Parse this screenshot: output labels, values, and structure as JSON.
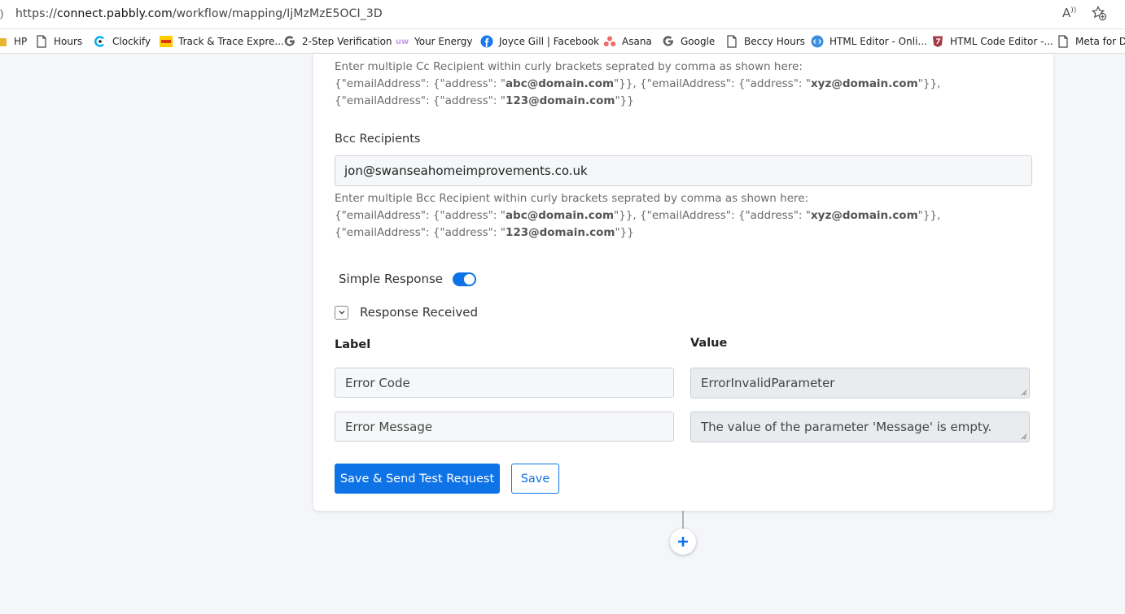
{
  "browser": {
    "lead_char": ")",
    "url_prefix": "https://",
    "url_host": "connect.pabbly.com",
    "url_path": "/workflow/mapping/IjMzMzE5OCI_3D",
    "read_aloud_glyph": "Aͅ",
    "read_aloud_icon": "read-aloud-icon",
    "favorites_icon": "add-favorite-icon"
  },
  "bookmarks": [
    {
      "label": "HP",
      "icon": "folder-icon"
    },
    {
      "label": "Hours",
      "icon": "page-icon"
    },
    {
      "label": "Clockify",
      "icon": "clockify-icon"
    },
    {
      "label": "Track & Trace Expre...",
      "icon": "dhl-icon"
    },
    {
      "label": "2-Step Verification",
      "icon": "google-icon"
    },
    {
      "label": "Your Energy",
      "icon": "utility-warehouse-icon"
    },
    {
      "label": "Joyce Gill | Facebook",
      "icon": "facebook-icon"
    },
    {
      "label": "Asana",
      "icon": "asana-icon"
    },
    {
      "label": "Google",
      "icon": "google-icon"
    },
    {
      "label": "Beccy Hours",
      "icon": "page-icon"
    },
    {
      "label": "HTML Editor - Onli...",
      "icon": "html-editor-icon"
    },
    {
      "label": "HTML Code Editor -...",
      "icon": "shield-icon"
    },
    {
      "label": "Meta for De",
      "icon": "page-icon"
    }
  ],
  "cc_hint": {
    "line1": "Enter multiple Cc Recipient within curly brackets seprated by comma as shown here:",
    "p1": "{\"emailAddress\": {\"address\": \"",
    "e1": "abc@domain.com",
    "p2": "\"}}, {\"emailAddress\": {\"address\": \"",
    "e2": "xyz@domain.com",
    "p3": "\"}},",
    "p4": "{\"emailAddress\": {\"address\": \"",
    "e3": "123@domain.com",
    "p5": "\"}}"
  },
  "bcc": {
    "label": "Bcc Recipients",
    "value": "jon@swanseahomeimprovements.co.uk",
    "hint_line1": "Enter multiple Bcc Recipient within curly brackets seprated by comma as shown here:"
  },
  "simple_response": {
    "label": "Simple Response",
    "enabled": true,
    "accent": "#0f73e8"
  },
  "response_received": {
    "label": "Response Received",
    "icon": "chevron-down-icon"
  },
  "response_table": {
    "label_header": "Label",
    "value_header": "Value",
    "rows": [
      {
        "label": "Error Code",
        "value": "ErrorInvalidParameter"
      },
      {
        "label": "Error Message",
        "value": "The value of the parameter 'Message' is empty."
      }
    ]
  },
  "actions": {
    "save_send_label": "Save & Send Test Request",
    "save_label": "Save"
  },
  "add_step": {
    "icon": "plus-icon",
    "glyph": "+"
  }
}
